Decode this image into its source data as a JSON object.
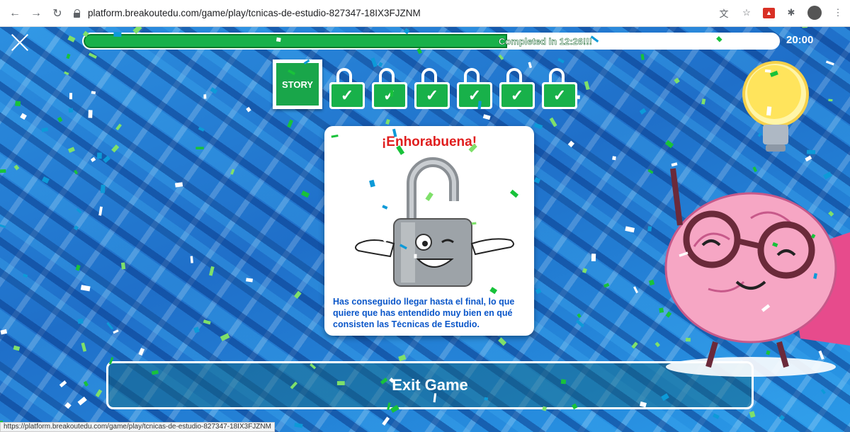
{
  "browser": {
    "back_icon": "arrow-left-icon",
    "forward_icon": "arrow-right-icon",
    "reload_icon": "reload-icon",
    "url": "platform.breakoutedu.com/game/play/tcnicas-de-estudio-827347-18IX3FJZNM",
    "status_url": "https://platform.breakoutedu.com/game/play/tcnicas-de-estudio-827347-18IX3FJZNM"
  },
  "game": {
    "progress_text": "Completed in 12:26!!!",
    "progress_fraction": 0.61,
    "timer": "20:00",
    "story_label": "STORY",
    "locks": [
      {
        "glyph": "✓"
      },
      {
        "glyph": "✓"
      },
      {
        "glyph": "✓"
      },
      {
        "glyph": "✓"
      },
      {
        "glyph": "✓"
      },
      {
        "glyph": "✓"
      }
    ],
    "card": {
      "title": "¡Enhorabuena!",
      "message": "Has conseguido llegar hasta el final, lo que quiere que has entendido muy bien en qué consisten las Técnicas de Estudio."
    },
    "exit_label": "Exit Game"
  },
  "colors": {
    "accent_green": "#18b14a",
    "title_red": "#e01e1e",
    "text_blue": "#0a56c9",
    "maze_blue": "#1f6fc9"
  }
}
